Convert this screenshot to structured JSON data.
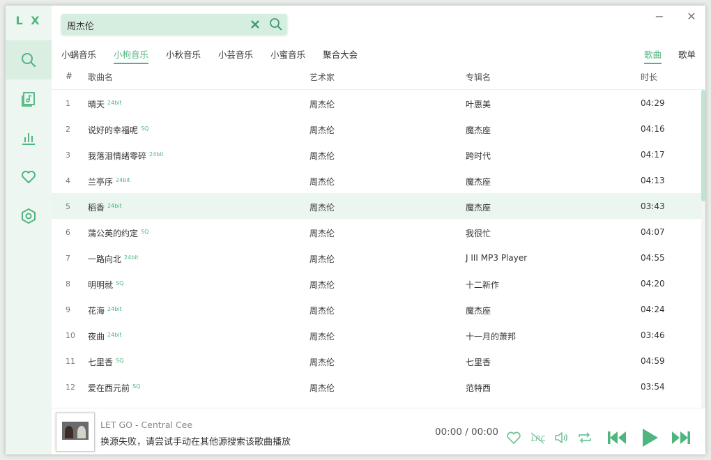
{
  "app": {
    "logo": "L X"
  },
  "sidebar": {
    "items": [
      {
        "name": "search",
        "icon": "search-icon",
        "active": true
      },
      {
        "name": "song-list",
        "icon": "music-list-icon",
        "active": false
      },
      {
        "name": "leaderboard",
        "icon": "chart-bars-icon",
        "active": false
      },
      {
        "name": "favorites",
        "icon": "heart-icon",
        "active": false
      },
      {
        "name": "settings",
        "icon": "hexagon-settings-icon",
        "active": false
      }
    ]
  },
  "search": {
    "value": "周杰伦",
    "placeholder": ""
  },
  "window": {
    "minimize": "−",
    "close": "✕"
  },
  "source_tabs": [
    {
      "label": "小蜗音乐",
      "active": false
    },
    {
      "label": "小枸音乐",
      "active": true
    },
    {
      "label": "小秋音乐",
      "active": false
    },
    {
      "label": "小芸音乐",
      "active": false
    },
    {
      "label": "小蜜音乐",
      "active": false
    },
    {
      "label": "聚合大会",
      "active": false
    }
  ],
  "type_tabs": [
    {
      "label": "歌曲",
      "active": true
    },
    {
      "label": "歌单",
      "active": false
    }
  ],
  "table": {
    "headers": {
      "num": "#",
      "name": "歌曲名",
      "artist": "艺术家",
      "album": "专辑名",
      "duration": "时长"
    },
    "rows": [
      {
        "num": "1",
        "name": "晴天",
        "quality": "24bit",
        "artist": "周杰伦",
        "album": "叶惠美",
        "duration": "04:29"
      },
      {
        "num": "2",
        "name": "说好的幸福呢",
        "quality": "SQ",
        "artist": "周杰伦",
        "album": "魔杰座",
        "duration": "04:16"
      },
      {
        "num": "3",
        "name": "我落泪情绪零碎",
        "quality": "24bit",
        "artist": "周杰伦",
        "album": "跨时代",
        "duration": "04:17"
      },
      {
        "num": "4",
        "name": "兰亭序",
        "quality": "24bit",
        "artist": "周杰伦",
        "album": "魔杰座",
        "duration": "04:13"
      },
      {
        "num": "5",
        "name": "稻香",
        "quality": "24bit",
        "artist": "周杰伦",
        "album": "魔杰座",
        "duration": "03:43"
      },
      {
        "num": "6",
        "name": "蒲公英的约定",
        "quality": "SQ",
        "artist": "周杰伦",
        "album": "我很忙",
        "duration": "04:07"
      },
      {
        "num": "7",
        "name": "一路向北",
        "quality": "24bit",
        "artist": "周杰伦",
        "album": "J III MP3 Player",
        "duration": "04:55"
      },
      {
        "num": "8",
        "name": "明明就",
        "quality": "SQ",
        "artist": "周杰伦",
        "album": "十二新作",
        "duration": "04:20"
      },
      {
        "num": "9",
        "name": "花海",
        "quality": "24bit",
        "artist": "周杰伦",
        "album": "魔杰座",
        "duration": "04:24"
      },
      {
        "num": "10",
        "name": "夜曲",
        "quality": "24bit",
        "artist": "周杰伦",
        "album": "十一月的萧邦",
        "duration": "03:46"
      },
      {
        "num": "11",
        "name": "七里香",
        "quality": "SQ",
        "artist": "周杰伦",
        "album": "七里香",
        "duration": "04:59"
      },
      {
        "num": "12",
        "name": "爱在西元前",
        "quality": "SQ",
        "artist": "周杰伦",
        "album": "范特西",
        "duration": "03:54"
      }
    ],
    "selected_row": "5"
  },
  "player": {
    "title": "LET GO - Central Cee",
    "status": "换源失败，请尝试手动在其他源搜索该歌曲播放",
    "time": "00:00 / 00:00",
    "controls": [
      "heart-outline-icon",
      "lyrics-icon",
      "volume-icon",
      "repeat-icon",
      "prev-icon",
      "play-icon",
      "next-icon"
    ]
  },
  "colors": {
    "accent": "#4fb57f",
    "sidebar_bg": "#eef6f1",
    "selected_row": "#ecf6f0"
  }
}
